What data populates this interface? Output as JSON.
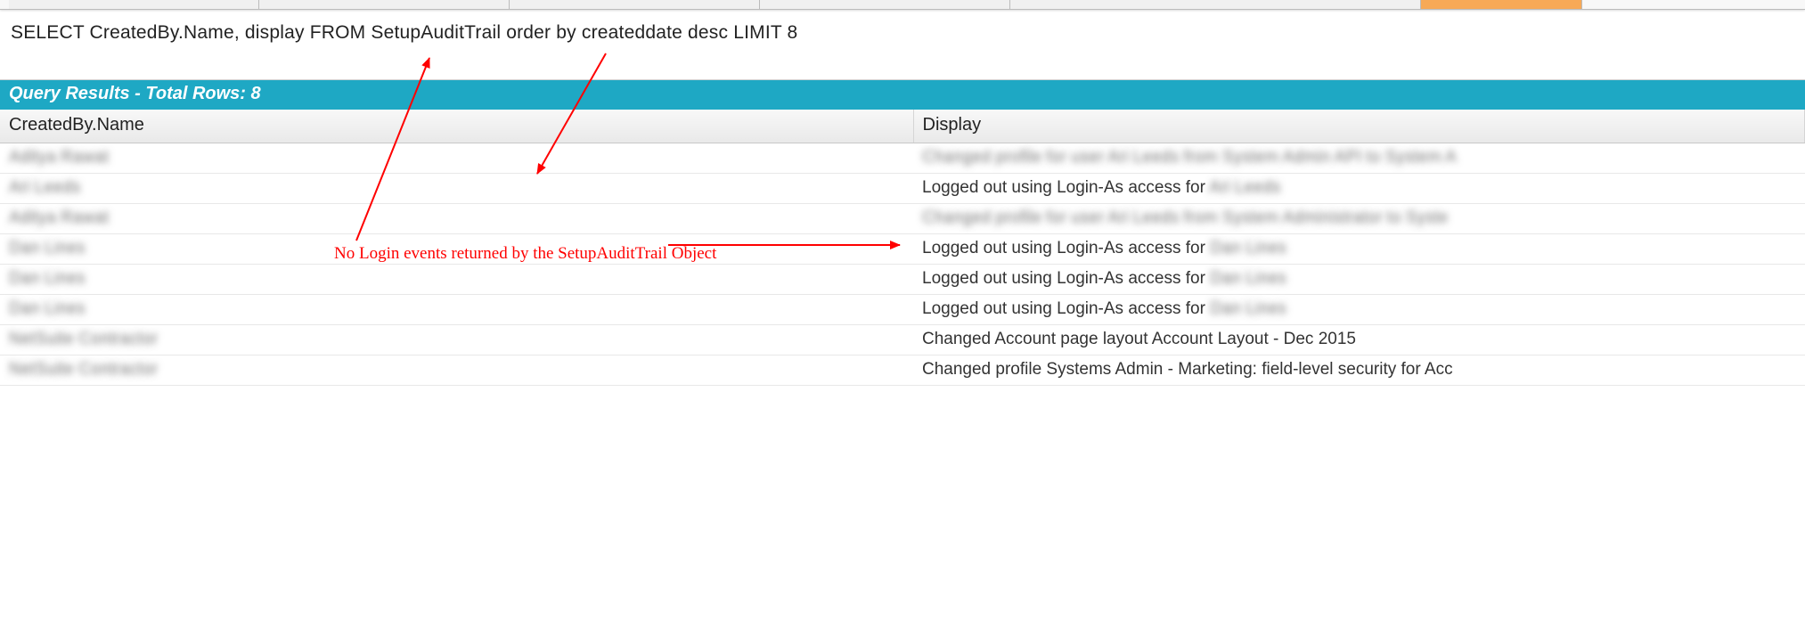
{
  "tabs": {
    "count_plain": 5,
    "highlighted": true
  },
  "query": "SELECT CreatedBy.Name, display FROM SetupAuditTrail order by createddate desc LIMIT 8",
  "results_header": "Query Results - Total Rows: 8",
  "columns": {
    "col0": "CreatedBy.Name",
    "col1": "Display"
  },
  "rows": [
    {
      "name": "Aditya Rawat",
      "name_blur": true,
      "display_pre": "Changed profile for user Ari Leeds from System Admin API to System A",
      "display_blur_tail": "",
      "display_blur_all": true
    },
    {
      "name": "Ari Leeds",
      "name_blur": true,
      "display_pre": "Logged out using Login-As access for ",
      "display_blur_tail": "Ari Leeds",
      "display_blur_all": false
    },
    {
      "name": "Aditya Rawat",
      "name_blur": true,
      "display_pre": "Changed profile for user Ari Leeds from System Administrator to Syste",
      "display_blur_tail": "",
      "display_blur_all": true
    },
    {
      "name": "Dan Lines",
      "name_blur": true,
      "display_pre": "Logged out using Login-As access for ",
      "display_blur_tail": "Dan Lines",
      "display_blur_all": false
    },
    {
      "name": "Dan Lines",
      "name_blur": true,
      "display_pre": "Logged out using Login-As access for ",
      "display_blur_tail": "Dan Lines",
      "display_blur_all": false
    },
    {
      "name": "Dan Lines",
      "name_blur": true,
      "display_pre": "Logged out using Login-As access for ",
      "display_blur_tail": "Dan Lines",
      "display_blur_all": false
    },
    {
      "name": "NetSuite Contractor",
      "name_blur": true,
      "display_pre": "Changed Account page layout Account Layout - Dec 2015",
      "display_blur_tail": "",
      "display_blur_all": false
    },
    {
      "name": "NetSuite Contractor",
      "name_blur": true,
      "display_pre": "Changed profile Systems Admin - Marketing: field-level security for Acc",
      "display_blur_tail": "",
      "display_blur_all": false
    }
  ],
  "annotation": "No Login events returned by the SetupAuditTrail Object",
  "colors": {
    "accent": "#1ea8c4",
    "annotation": "#ff0000",
    "tab_highlight": "#f7a957"
  }
}
